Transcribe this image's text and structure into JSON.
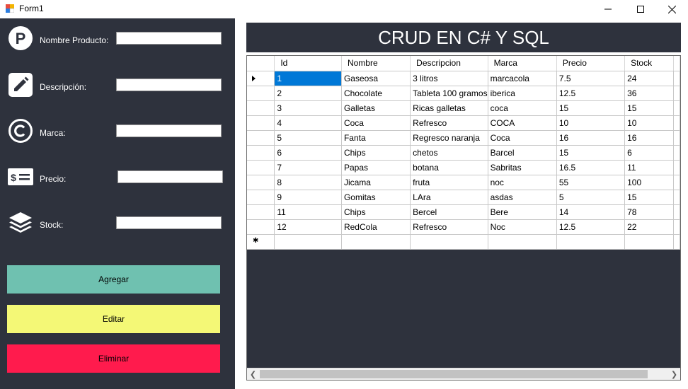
{
  "window": {
    "title": "Form1"
  },
  "form": {
    "fields": [
      {
        "label": "Nombre Producto:",
        "icon": "parking-circle-icon",
        "value": ""
      },
      {
        "label": "Descripción:",
        "icon": "pencil-icon",
        "value": ""
      },
      {
        "label": "Marca:",
        "icon": "copyright-icon",
        "value": ""
      },
      {
        "label": "Precio:",
        "icon": "money-card-icon",
        "value": ""
      },
      {
        "label": "Stock:",
        "icon": "layers-icon",
        "value": ""
      }
    ],
    "buttons": {
      "add": "Agregar",
      "edit": "Editar",
      "delete": "Eliminar"
    }
  },
  "header": {
    "title": "CRUD EN C# Y SQL"
  },
  "grid": {
    "columns": [
      "Id",
      "Nombre",
      "Descripcion",
      "Marca",
      "Precio",
      "Stock"
    ],
    "rows": [
      [
        "1",
        "Gaseosa",
        "3 litros",
        "marcacola",
        "7.5",
        "24"
      ],
      [
        "2",
        "Chocolate",
        "Tableta 100 gramos",
        "iberica",
        "12.5",
        "36"
      ],
      [
        "3",
        "Galletas",
        "Ricas galletas",
        "coca",
        "15",
        "15"
      ],
      [
        "4",
        "Coca",
        "Refresco",
        "COCA",
        "10",
        "10"
      ],
      [
        "5",
        "Fanta",
        "Regresco naranja",
        "Coca",
        "16",
        "16"
      ],
      [
        "6",
        "Chips",
        "chetos",
        "Barcel",
        "15",
        "6"
      ],
      [
        "7",
        "Papas",
        "botana",
        "Sabritas",
        "16.5",
        "11"
      ],
      [
        "8",
        "Jicama",
        "fruta",
        "noc",
        "55",
        "100"
      ],
      [
        "9",
        "Gomitas",
        "LAra",
        "asdas",
        "5",
        "15"
      ],
      [
        "11",
        "Chips",
        "Bercel",
        "Bere",
        "14",
        "78"
      ],
      [
        "12",
        "RedCola",
        "Refresco",
        "Noc",
        "12.5",
        "22"
      ]
    ],
    "selected_row": 0
  },
  "colors": {
    "panel": "#2e323d",
    "add_button": "#6fc1b0",
    "edit_button": "#f4f876",
    "delete_button": "#ff1b4d",
    "selection": "#0078d7"
  }
}
